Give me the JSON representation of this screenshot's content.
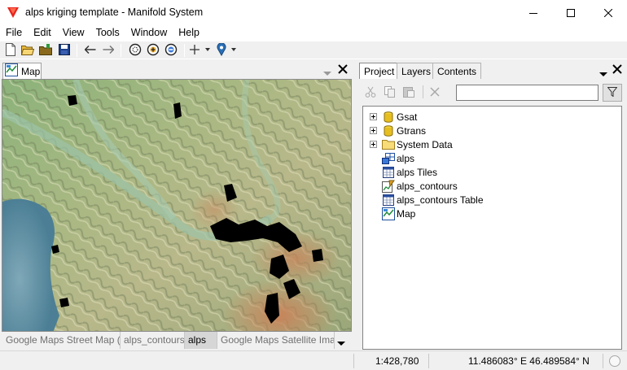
{
  "window": {
    "title": "alps kriging template - Manifold System",
    "controls": {
      "minimize_icon": "minimize-icon",
      "maximize_icon": "maximize-icon",
      "close_icon": "close-icon"
    },
    "accent": "#e8251e"
  },
  "menu": [
    "File",
    "Edit",
    "View",
    "Tools",
    "Window",
    "Help"
  ],
  "toolbar": {
    "icons": [
      "new-icon",
      "open-icon",
      "open-folder-icon",
      "save-icon",
      "back-icon",
      "forward-icon",
      "zoom-fit-icon",
      "zoom-in-icon",
      "zoom-out-icon",
      "add-icon",
      "locate-pin-icon"
    ]
  },
  "map_pane": {
    "tab_label": "Map",
    "layer_tabs": [
      "Google Maps Street Map (T...",
      "alps_contours",
      "alps",
      "Google Maps Satellite Imag..."
    ],
    "active_layer": "alps"
  },
  "project_pane": {
    "tabs": [
      "Project",
      "Layers",
      "Contents"
    ],
    "active_tab": "Project",
    "search_placeholder": "",
    "tree": [
      {
        "label": "Gsat",
        "icon": "database-icon",
        "expandable": true
      },
      {
        "label": "Gtrans",
        "icon": "database-icon",
        "expandable": true
      },
      {
        "label": "System Data",
        "icon": "folder-icon",
        "expandable": true
      },
      {
        "label": "alps",
        "icon": "tiles-layer-icon",
        "expandable": false
      },
      {
        "label": "alps Tiles",
        "icon": "table-icon",
        "expandable": false
      },
      {
        "label": "alps_contours",
        "icon": "drawing-icon",
        "expandable": false
      },
      {
        "label": "alps_contours Table",
        "icon": "table-icon",
        "expandable": false
      },
      {
        "label": "Map",
        "icon": "map-icon",
        "expandable": false
      }
    ]
  },
  "status": {
    "scale": "1:428,780",
    "coords": "11.486083° E 46.489584° N"
  }
}
